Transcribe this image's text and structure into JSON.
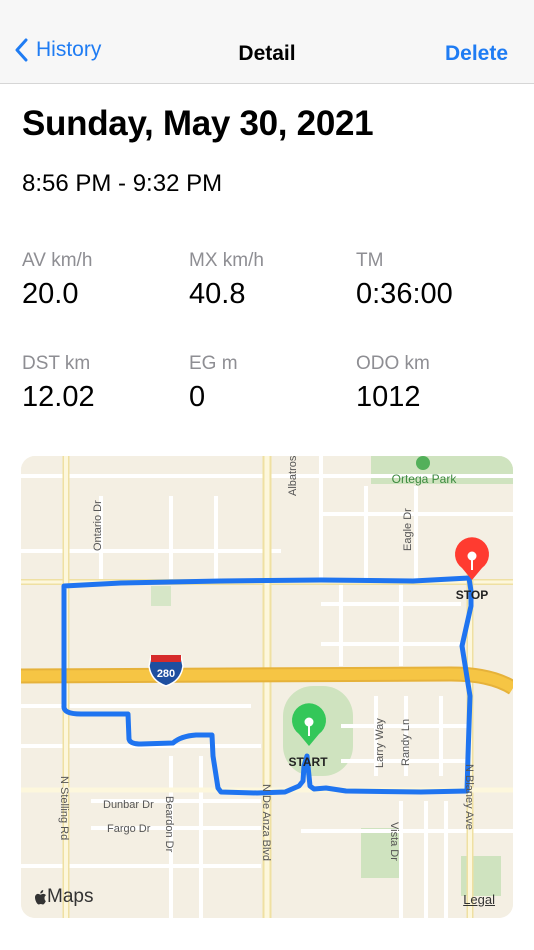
{
  "nav": {
    "back_label": "History",
    "title": "Detail",
    "delete_label": "Delete"
  },
  "ride": {
    "date": "Sunday, May 30, 2021",
    "time_range": "8:56 PM - 9:32 PM"
  },
  "stats": [
    {
      "label": "AV km/h",
      "value": "20.0"
    },
    {
      "label": "MX km/h",
      "value": "40.8"
    },
    {
      "label": "TM",
      "value": "0:36:00"
    },
    {
      "label": "DST km",
      "value": "12.02"
    },
    {
      "label": "EG m",
      "value": "0"
    },
    {
      "label": "ODO km",
      "value": "1012"
    }
  ],
  "map": {
    "park_label": "Ortega Park",
    "start_label": "START",
    "stop_label": "STOP",
    "highway_shield": "280",
    "streets": {
      "albatross": "Albatross",
      "ontario": "Ontario Dr",
      "eagle": "Eagle Dr",
      "larry": "Larry Way",
      "randy": "Randy Ln",
      "dunbar": "Dunbar Dr",
      "fargo": "Fargo Dr",
      "beardon": "Beardon Dr",
      "vista": "Vista Dr",
      "stelling": "N Stelling Rd",
      "de_anza": "N De Anza Blvd",
      "blaney": "N Blaney Ave"
    },
    "attribution": "Maps",
    "legal": "Legal",
    "colors": {
      "route": "#1f74f0",
      "start_pin": "#34c759",
      "stop_pin": "#ff3b30",
      "highway": "#f6c544",
      "park": "#cfe3bf",
      "land": "#f4efe3"
    }
  }
}
